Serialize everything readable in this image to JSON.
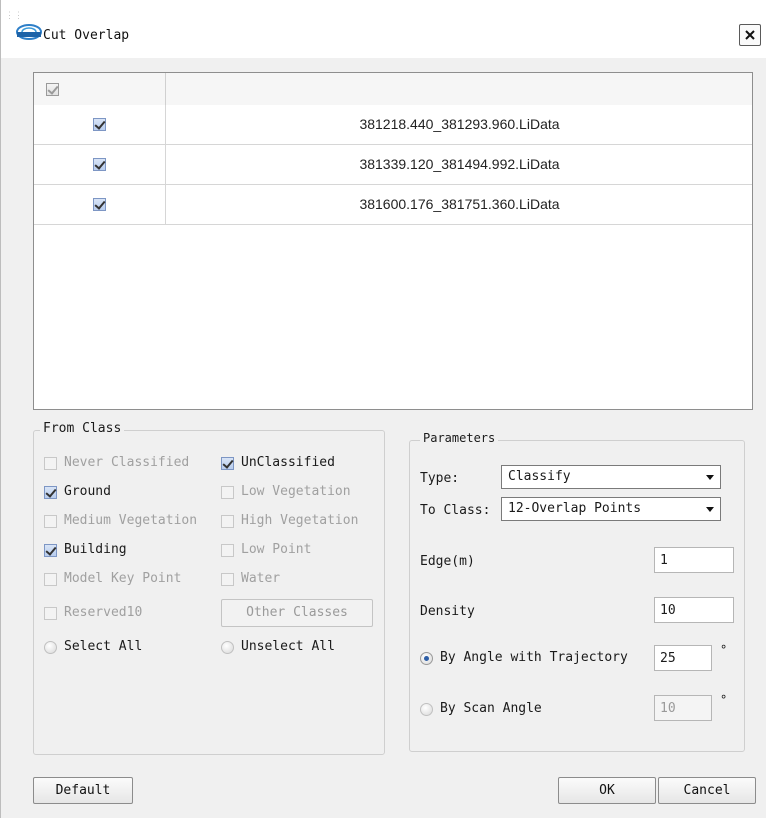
{
  "window": {
    "title": "Cut Overlap",
    "close_icon": "close-icon",
    "logo_icon": "lidar-logo-icon"
  },
  "files": {
    "header_checkbox_checked": true,
    "rows": [
      {
        "checked": true,
        "name": "381218.440_381293.960.LiData"
      },
      {
        "checked": true,
        "name": "381339.120_381494.992.LiData"
      },
      {
        "checked": true,
        "name": "381600.176_381751.360.LiData"
      }
    ]
  },
  "from_class": {
    "legend": "From Class",
    "never_classified": "Never Classified",
    "unclassified": "UnClassified",
    "ground": "Ground",
    "low_vegetation": "Low Vegetation",
    "medium_vegetation": "Medium Vegetation",
    "high_vegetation": "High Vegetation",
    "building": "Building",
    "low_point": "Low Point",
    "model_key_point": "Model Key Point",
    "water": "Water",
    "reserved10": "Reserved10",
    "other_classes": "Other Classes",
    "select_all": "Select All",
    "unselect_all": "Unselect All"
  },
  "parameters": {
    "legend": "Parameters",
    "type_label": "Type:",
    "type_value": "Classify",
    "to_class_label": "To Class:",
    "to_class_value": "12-Overlap Points",
    "edge_label": "Edge(m)",
    "edge_value": "1",
    "density_label": "Density",
    "density_value": "10",
    "by_angle_label": "By Angle with Trajectory",
    "by_angle_value": "25",
    "by_scan_label": "By Scan Angle",
    "by_scan_value": "10",
    "degree_symbol": "°"
  },
  "footer": {
    "default": "Default",
    "ok": "OK",
    "cancel": "Cancel"
  }
}
